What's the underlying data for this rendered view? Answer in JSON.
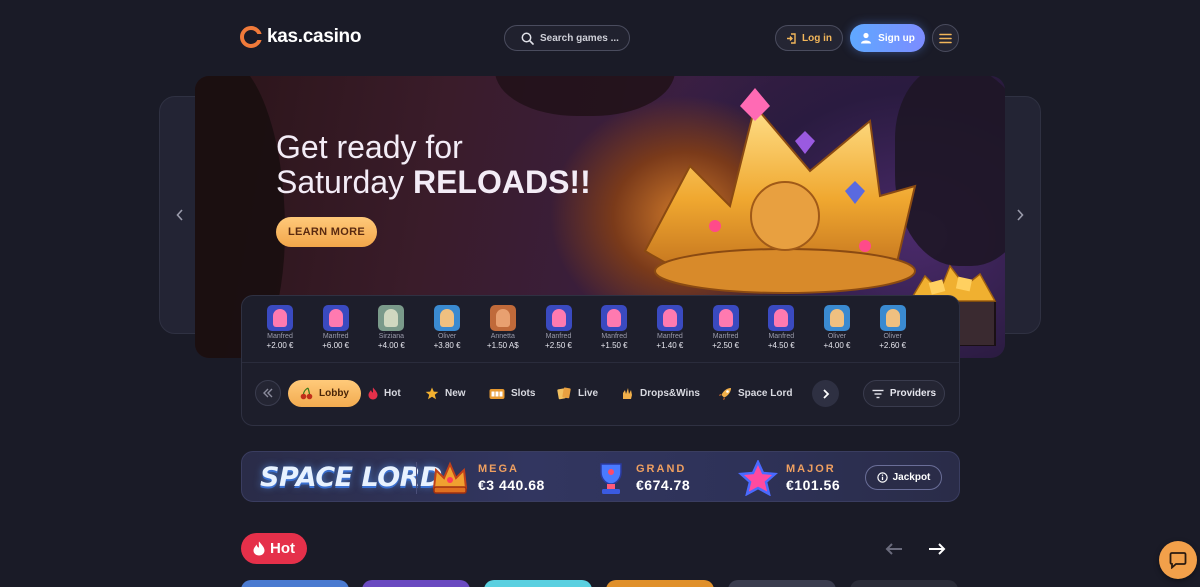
{
  "header": {
    "logo_text": "kas.casino",
    "search_placeholder": "Search games ...",
    "login_label": "Log in",
    "signup_label": "Sign up"
  },
  "hero": {
    "line1": "Get ready for",
    "line2_prefix": "Saturday",
    "line2_bold": "RELOADS!!",
    "cta_label": "LEARN MORE"
  },
  "winners": [
    {
      "name": "Manfred",
      "amount": "+2.00 €",
      "avatar": "pink-hair"
    },
    {
      "name": "Manfred",
      "amount": "+6.00 €",
      "avatar": "pink-hair"
    },
    {
      "name": "Sirziana",
      "amount": "+4.00 €",
      "avatar": "statue"
    },
    {
      "name": "Oliver",
      "amount": "+3.80 €",
      "avatar": "blue-bg"
    },
    {
      "name": "Annetta",
      "amount": "+1.50 A$",
      "avatar": "redhead"
    },
    {
      "name": "Manfred",
      "amount": "+2.50 €",
      "avatar": "pink-hair"
    },
    {
      "name": "Manfred",
      "amount": "+1.50 €",
      "avatar": "pink-hair"
    },
    {
      "name": "Manfred",
      "amount": "+1.40 €",
      "avatar": "pink-hair"
    },
    {
      "name": "Manfred",
      "amount": "+2.50 €",
      "avatar": "pink-hair"
    },
    {
      "name": "Manfred",
      "amount": "+4.50 €",
      "avatar": "pink-hair"
    },
    {
      "name": "Oliver",
      "amount": "+4.00 €",
      "avatar": "blue-bg"
    },
    {
      "name": "Oliver",
      "amount": "+2.60 €",
      "avatar": "blue-bg"
    }
  ],
  "categories": [
    {
      "label": "Lobby",
      "icon": "cherries-icon",
      "active": true
    },
    {
      "label": "Hot",
      "icon": "flame-icon",
      "active": false
    },
    {
      "label": "New",
      "icon": "star-icon",
      "active": false
    },
    {
      "label": "Slots",
      "icon": "slot-machine-icon",
      "active": false
    },
    {
      "label": "Live",
      "icon": "cards-icon",
      "active": false
    },
    {
      "label": "Drops&Wins",
      "icon": "hand-icon",
      "active": false
    },
    {
      "label": "Space Lord",
      "icon": "rocket-icon",
      "active": false
    }
  ],
  "providers_label": "Providers",
  "jackpot": {
    "brand": "SPACE LORD",
    "tiers": [
      {
        "label": "MEGA",
        "value": "€3 440.68",
        "icon": "crown-icon"
      },
      {
        "label": "GRAND",
        "value": "€674.78",
        "icon": "trophy-icon"
      },
      {
        "label": "MAJOR",
        "value": "€101.56",
        "icon": "star-icon"
      }
    ],
    "button_label": "Jackpot"
  },
  "hot_section": {
    "label": "Hot"
  },
  "colors": {
    "background": "#1a1b27",
    "accent_orange": "#f2ab50",
    "accent_blue": "#6a9cff",
    "hot_red": "#e5304a"
  }
}
